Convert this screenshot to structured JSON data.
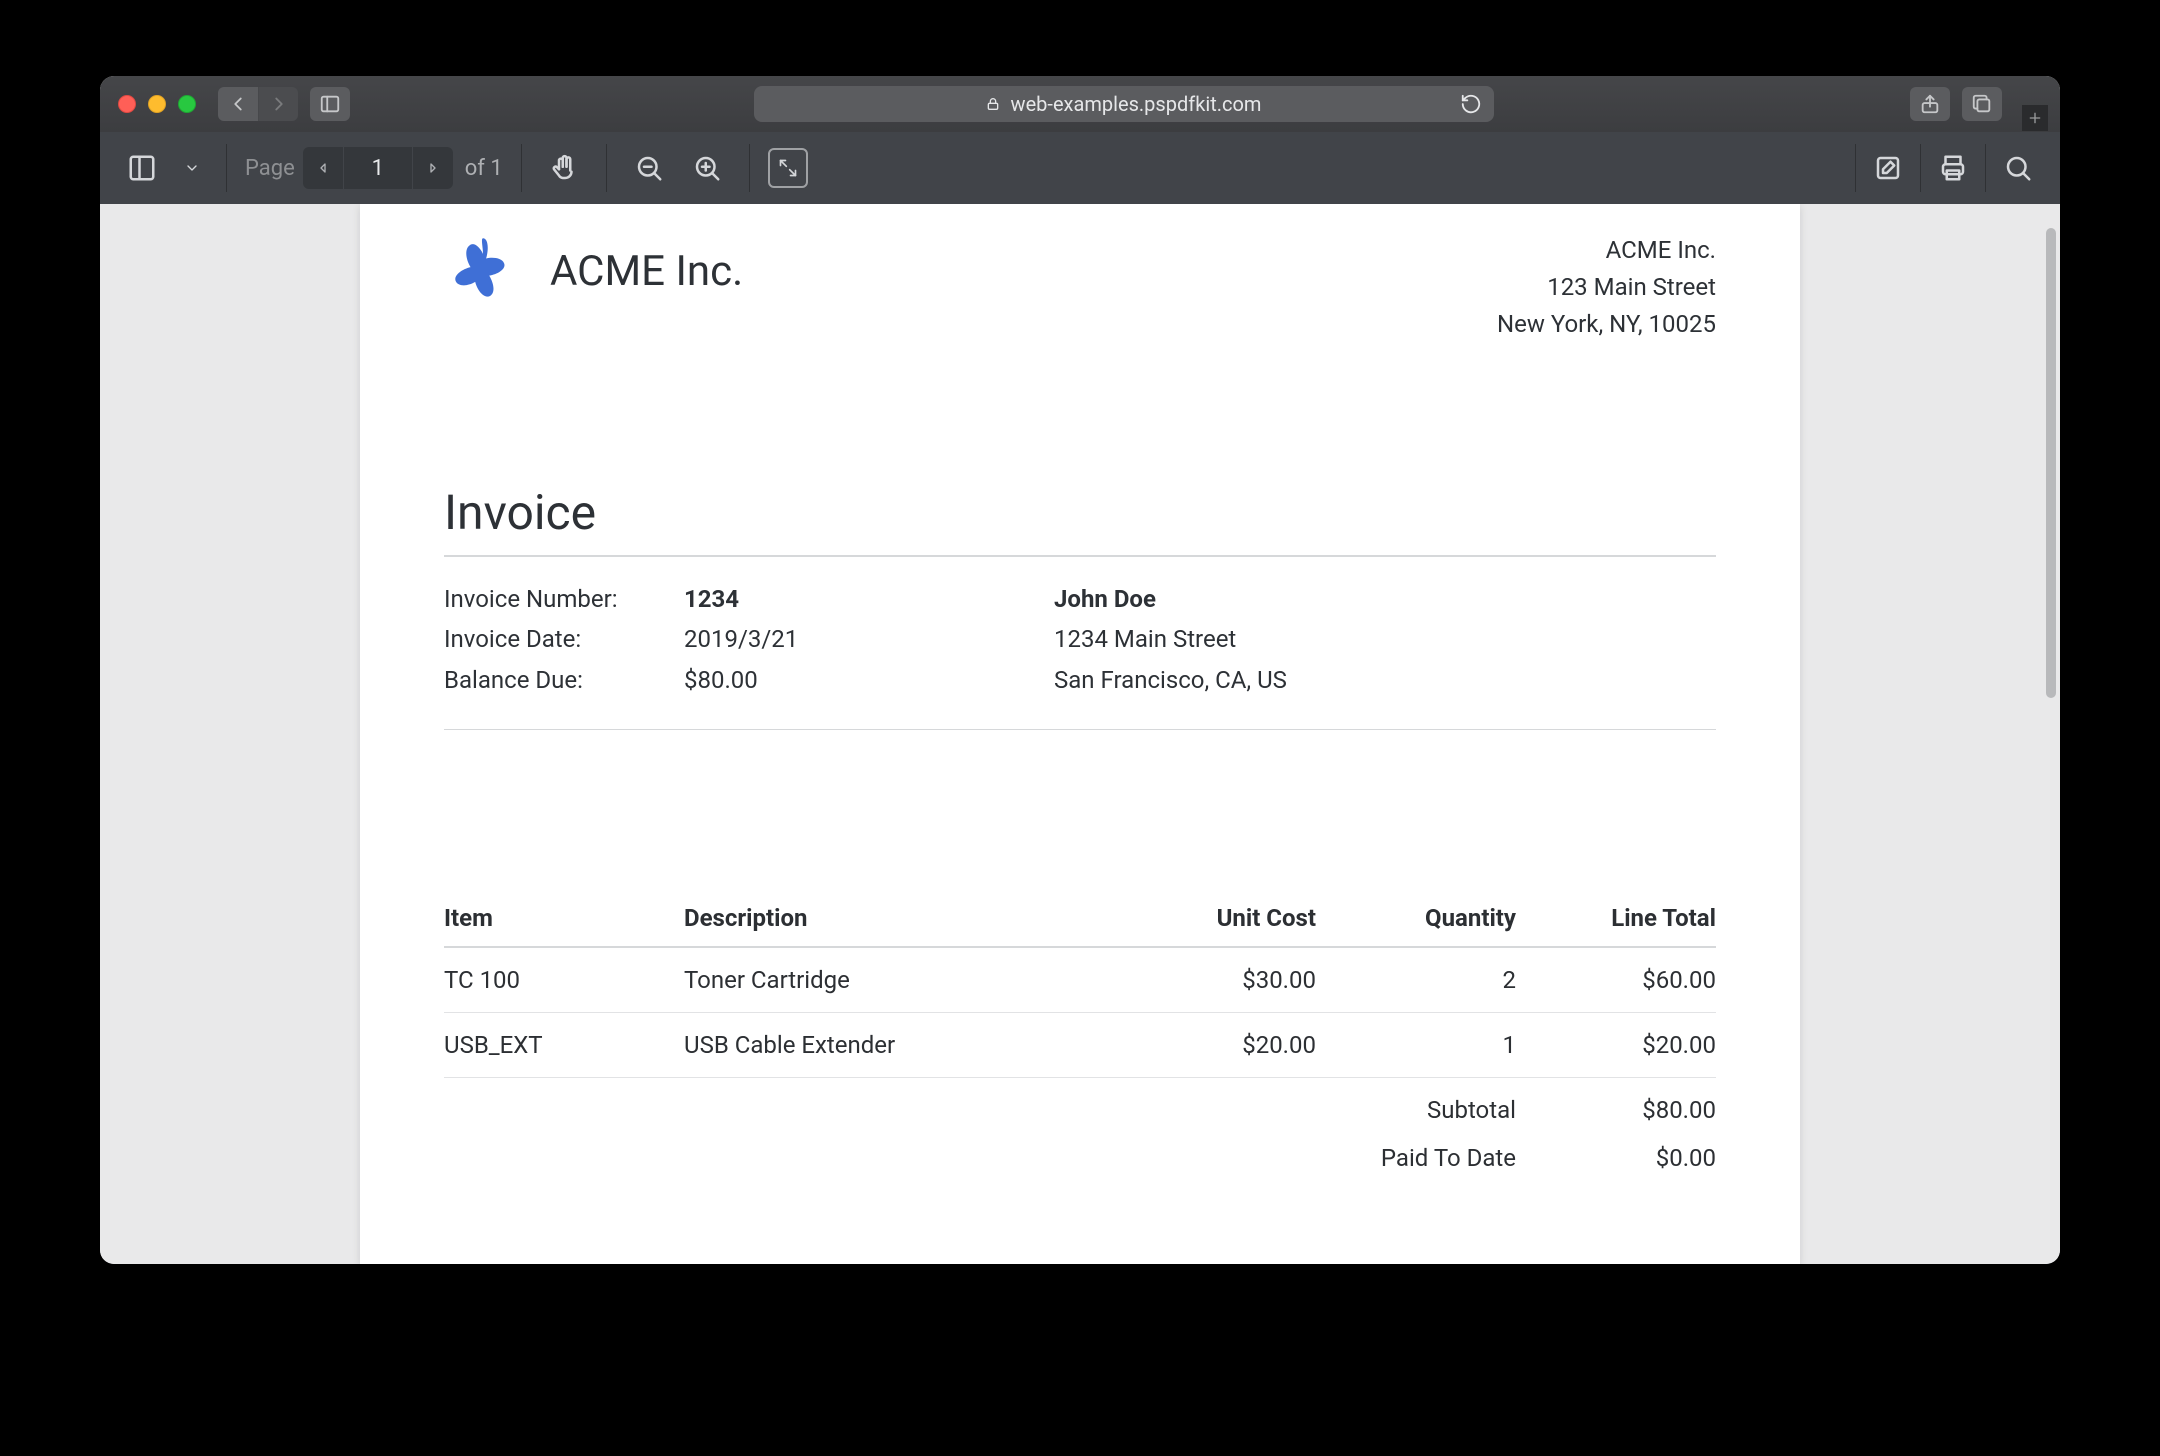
{
  "browser": {
    "url": "web-examples.pspdfkit.com"
  },
  "pdf_toolbar": {
    "page_label": "Page",
    "page_current": "1",
    "page_of": "of 1"
  },
  "company": {
    "name": "ACME Inc.",
    "addr_name": "ACME Inc.",
    "addr_street": "123 Main Street",
    "addr_city": "New York, NY, 10025"
  },
  "invoice": {
    "title": "Invoice",
    "number_label": "Invoice Number:",
    "number": "1234",
    "date_label": "Invoice Date:",
    "date": "2019/3/21",
    "balance_label": "Balance Due:",
    "balance": "$80.00",
    "bill_to": {
      "name": "John Doe",
      "street": "1234 Main Street",
      "city": "San Francisco, CA, US"
    }
  },
  "columns": {
    "item": "Item",
    "desc": "Description",
    "unit": "Unit Cost",
    "qty": "Quantity",
    "line": "Line Total"
  },
  "rows": [
    {
      "item": "TC 100",
      "desc": "Toner Cartridge",
      "unit": "$30.00",
      "qty": "2",
      "line": "$60.00"
    },
    {
      "item": "USB_EXT",
      "desc": "USB Cable Extender",
      "unit": "$20.00",
      "qty": "1",
      "line": "$20.00"
    }
  ],
  "totals": {
    "subtotal_label": "Subtotal",
    "subtotal": "$80.00",
    "paid_label": "Paid To Date",
    "paid": "$0.00"
  }
}
